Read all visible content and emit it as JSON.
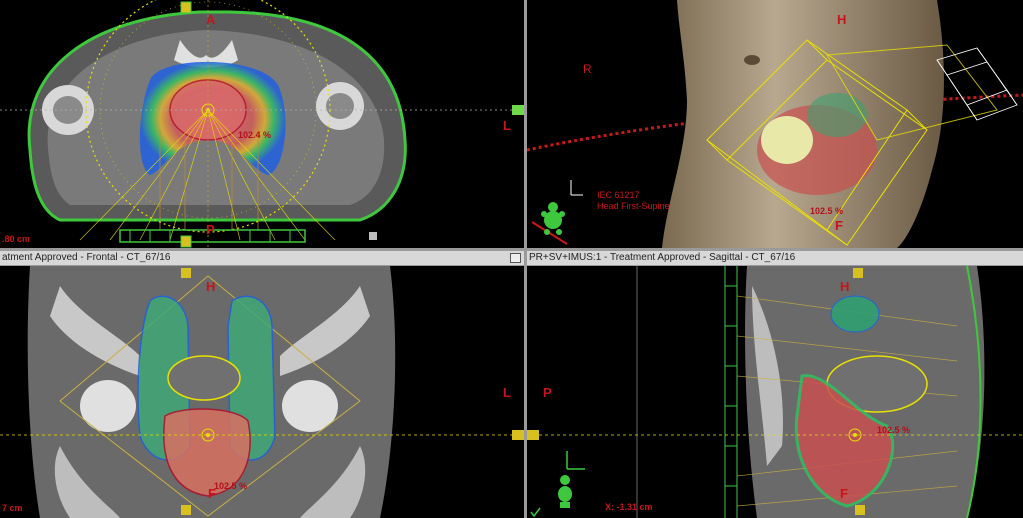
{
  "viewports": {
    "axial": {
      "label_top": "A",
      "label_bottom": "P",
      "label_right": "L",
      "dose_label": "102.4 %",
      "measure": ".80 cm"
    },
    "model3d": {
      "label_h": "H",
      "label_r": "R",
      "label_f": "F",
      "dose_label": "102.5 %",
      "iec_line1": "IEC 61217",
      "iec_line2": "Head First-Supine"
    },
    "frontal": {
      "header": "atment Approved - Frontal - CT_67/16",
      "label_h": "H",
      "label_f": "F",
      "label_l": "L",
      "dose_label": "102.5 %",
      "measure": "7 cm"
    },
    "sagittal": {
      "header": "PR+SV+IMUS:1  -  Treatment Approved - Sagittal - CT_67/16",
      "label_h": "H",
      "label_f": "F",
      "label_p": "P",
      "dose_label": "102.5 %",
      "coord": "X: -1.31 cm"
    }
  },
  "colors": {
    "orientation": "#c8141c",
    "body_contour": "#3ec83e",
    "beam_lines": "#e8e000",
    "bladder_contour": "#e8e000",
    "dose_high": "#e04040",
    "dose_mid": "#30c060",
    "dose_low": "#2060e0"
  },
  "icons": [
    "green-figure-icon",
    "axis-triad-icon",
    "checkmark-icon",
    "restore-window-icon"
  ]
}
